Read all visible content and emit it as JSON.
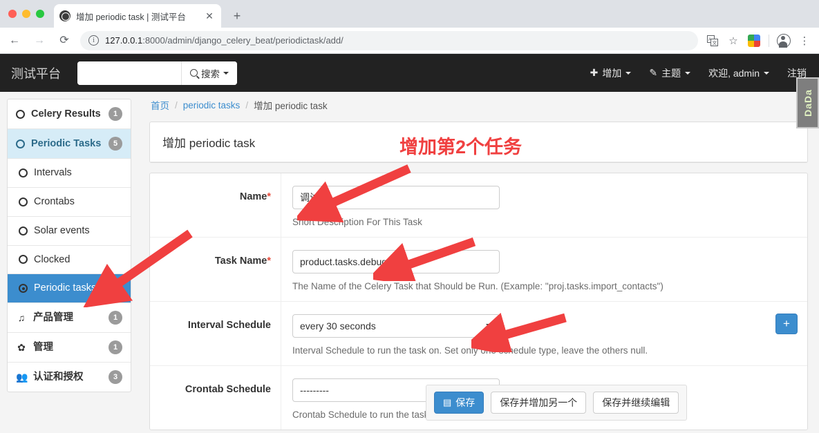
{
  "browser": {
    "tab_title": "增加 periodic task | 测试平台",
    "tab_close": "✕",
    "new_tab": "+",
    "back": "←",
    "forward": "→",
    "reload": "⟳",
    "url_host": "127.0.0.1",
    "url_rest": ":8000/admin/django_celery_beat/periodictask/add/",
    "info_icon": "i",
    "translate_icon": "translate-icon",
    "bookmark_icon": "☆",
    "menu_icon": "⋮"
  },
  "header": {
    "brand": "测试平台",
    "search_value": "",
    "search_placeholder": "",
    "search_button": "搜索",
    "nav": [
      {
        "label": "增加",
        "glyph": "✚",
        "caret": true
      },
      {
        "label": "主题",
        "glyph": "✎",
        "caret": true
      },
      {
        "label": "欢迎, admin",
        "glyph": "",
        "caret": true
      },
      {
        "label": "注销",
        "glyph": "",
        "caret": false
      }
    ]
  },
  "sidebar": {
    "items": [
      {
        "label": "Celery Results",
        "badge": "1",
        "icon": "ring-icon",
        "style": "head"
      },
      {
        "label": "Periodic Tasks",
        "badge": "5",
        "icon": "ring-icon",
        "style": "active-light"
      },
      {
        "label": "Intervals",
        "badge": "",
        "icon": "ring-icon",
        "style": "sub"
      },
      {
        "label": "Crontabs",
        "badge": "",
        "icon": "ring-icon",
        "style": "sub"
      },
      {
        "label": "Solar events",
        "badge": "",
        "icon": "ring-icon",
        "style": "sub"
      },
      {
        "label": "Clocked",
        "badge": "",
        "icon": "ring-icon",
        "style": "sub"
      },
      {
        "label": "Periodic tasks",
        "badge": "",
        "icon": "ring-dot-icon",
        "style": "active-blue"
      },
      {
        "label": "产品管理",
        "badge": "1",
        "icon": "music-note-icon",
        "style": "head"
      },
      {
        "label": "管理",
        "badge": "1",
        "icon": "gear-icon",
        "style": "head"
      },
      {
        "label": "认证和授权",
        "badge": "3",
        "icon": "users-icon",
        "style": "head"
      }
    ]
  },
  "breadcrumb": {
    "home": "首页",
    "sep": "/",
    "parent": "periodic tasks",
    "current": "增加 periodic task"
  },
  "page": {
    "title": "增加 periodic task"
  },
  "annotation": {
    "text": "增加第2个任务",
    "color": "#f04040"
  },
  "side_widget": {
    "label": "DaDa"
  },
  "form": {
    "rows": [
      {
        "label": "Name",
        "required": true,
        "control": "text",
        "value": "调试_2",
        "help": "Short Description For This Task"
      },
      {
        "label": "Task Name",
        "required": true,
        "control": "text",
        "value": "product.tasks.debug_2",
        "help": "The Name of the Celery Task that Should be Run. (Example: \"proj.tasks.import_contacts\")"
      },
      {
        "label": "Interval Schedule",
        "required": false,
        "control": "select",
        "value": "every 30 seconds",
        "help": "Interval Schedule to run the task on. Set only one schedule type, leave the others null.",
        "add_button": "+"
      },
      {
        "label": "Crontab Schedule",
        "required": false,
        "control": "select",
        "value": "---------",
        "help": "Crontab Schedule to run the task on. Set only one schedule type, leave the others null.",
        "add_button": ""
      }
    ]
  },
  "submit": {
    "save": "保存",
    "save_icon": "💾",
    "save_add_another": "保存并增加另一个",
    "save_continue": "保存并继续编辑"
  }
}
